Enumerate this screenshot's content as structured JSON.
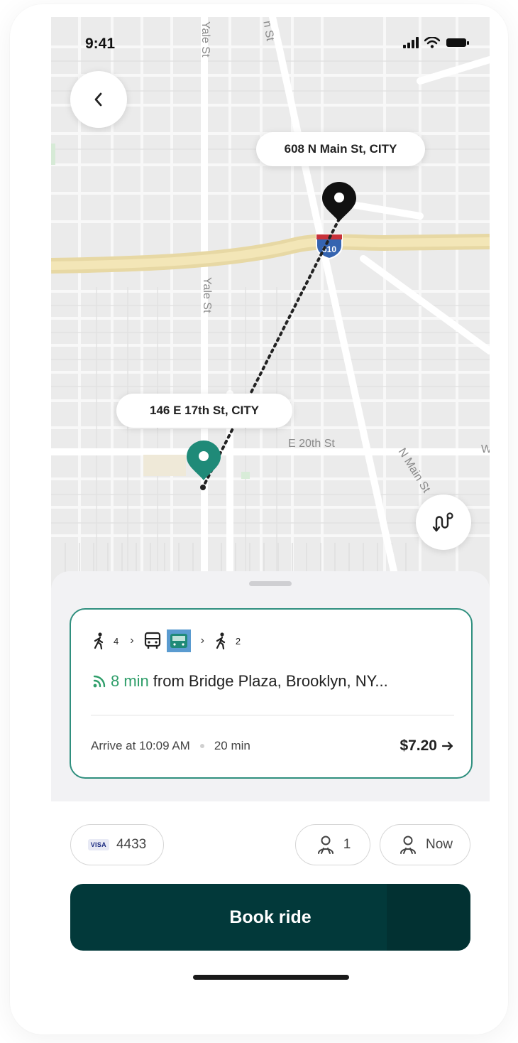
{
  "status_bar": {
    "time": "9:41"
  },
  "map": {
    "streets": [
      "Yale St",
      "Yale St",
      "n St",
      "E 20th St",
      "N Main St",
      "W"
    ],
    "highway_shield": "610",
    "destination_label": "608 N Main St, CITY",
    "origin_label": "146 E 17th St, CITY",
    "pin_colors": {
      "destination": "#111111",
      "origin": "#1f8a78"
    }
  },
  "trip": {
    "steps": [
      {
        "icon": "walk-icon",
        "value": "4"
      },
      {
        "icon": "bus-icon"
      },
      {
        "icon": "tram-icon"
      },
      {
        "icon": "walk-icon",
        "value": "2"
      }
    ],
    "realtime_eta": "8 min",
    "realtime_from": "from Bridge Plaza, Brooklyn, NY...",
    "arrive": "Arrive at 10:09 AM",
    "duration": "20 min",
    "price": "$7.20",
    "accent": "#2f8f7e"
  },
  "payment": {
    "brand": "VISA",
    "last4": "4433"
  },
  "passengers": {
    "count": "1"
  },
  "schedule": {
    "when": "Now"
  },
  "book_button": {
    "label": "Book ride",
    "color": "#02393a"
  }
}
